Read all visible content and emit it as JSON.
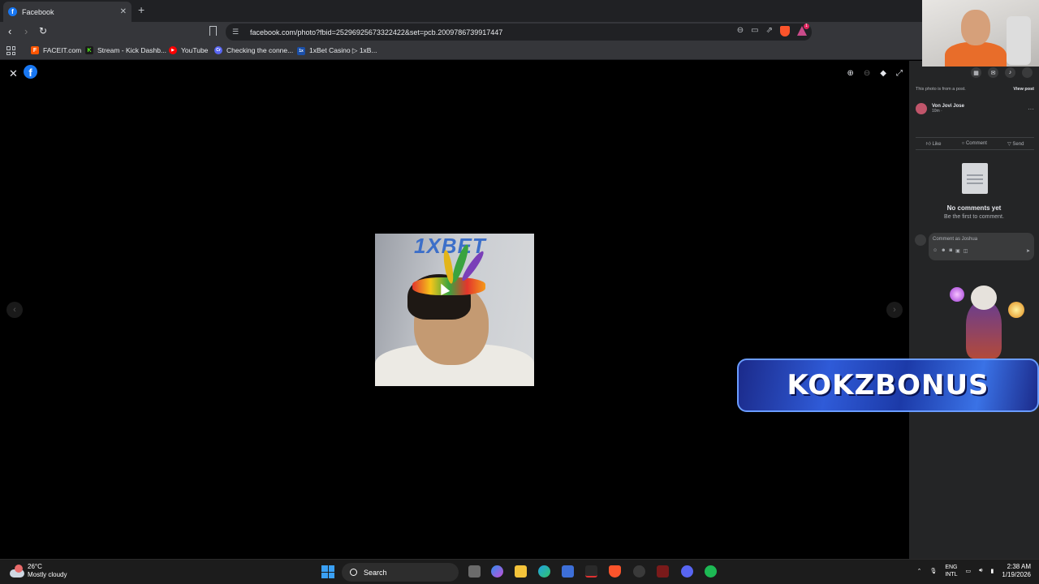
{
  "browser": {
    "tab_title": "Facebook",
    "tab_close": "✕",
    "new_tab": "+",
    "url": "facebook.com/photo?fbid=25296925673322422&set=pcb.2009786739917447",
    "brave_badge": "1",
    "bookmarks": [
      {
        "label": "FACEIT.com",
        "icon_color": "#ff5500",
        "icon_char": "F"
      },
      {
        "label": "Stream - Kick Dashb...",
        "icon_color": "#1a1a1a",
        "icon_char": "K"
      },
      {
        "label": "YouTube",
        "icon_color": "#ff0000",
        "icon_char": "▶"
      },
      {
        "label": "Checking the conne...",
        "icon_color": "#5865f2",
        "icon_char": "Cr"
      },
      {
        "label": "1xBet Casino ▷ 1xB...",
        "icon_color": "#1b4fa8",
        "icon_char": "1x"
      }
    ]
  },
  "viewer": {
    "close_label": "✕",
    "fb_glyph": "f",
    "prev_arrow": "‹",
    "next_arrow": "›"
  },
  "sidebar": {
    "photo_note": "This photo is from a post.",
    "view_post": "View post",
    "author_name": "Von Jovi Jose",
    "author_time": "10m ·",
    "more": "···",
    "actions": {
      "like": "Like",
      "comment": "Comment",
      "send": "Send"
    },
    "no_comments_title": "No comments yet",
    "no_comments_sub": "Be the first to comment.",
    "comment_placeholder": "Comment as Joshua"
  },
  "overlay": {
    "banner_text": "KOKZBONUS"
  },
  "taskbar": {
    "temperature": "26°C",
    "weather": "Mostly cloudy",
    "search_label": "Search",
    "lang_top": "ENG",
    "lang_bottom": "INTL",
    "time": "2:38 AM",
    "date": "1/19/2026"
  },
  "colors": {
    "facebook_blue": "#1877f2",
    "sidebar_bg": "#242526",
    "banner_blue": "#2f5bd8",
    "windows_blue": "#3aa0f5"
  }
}
